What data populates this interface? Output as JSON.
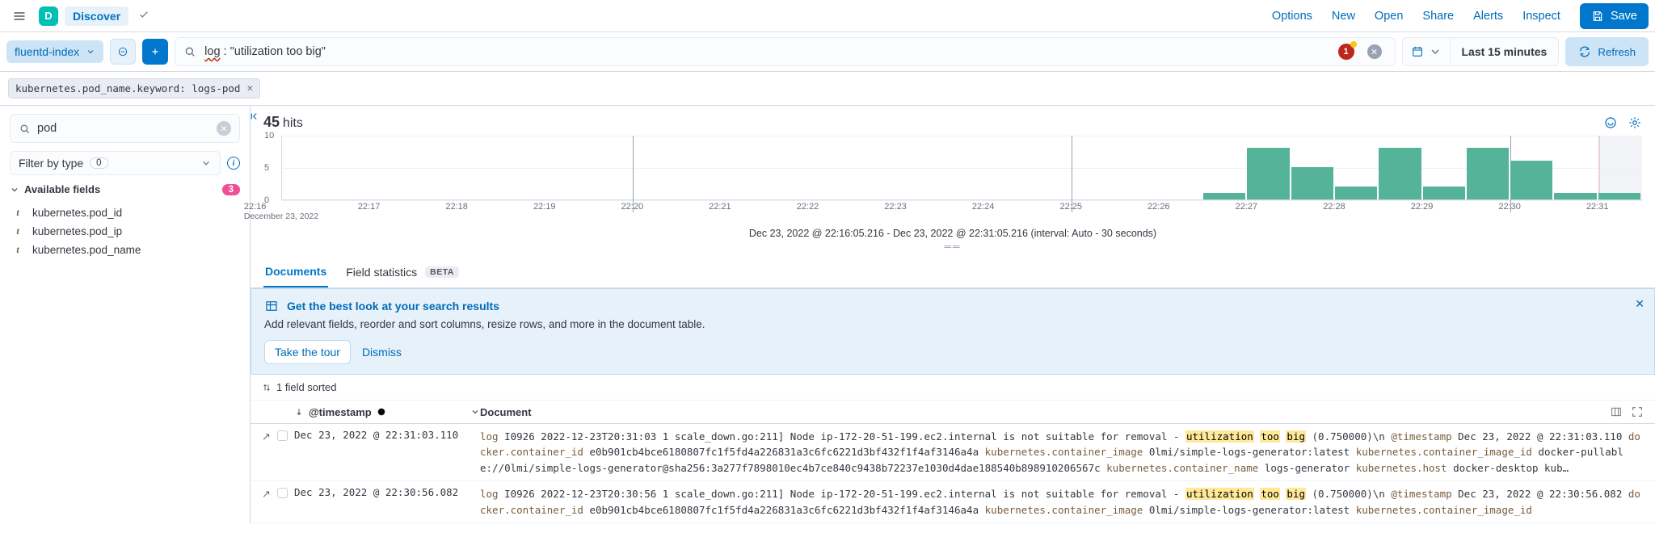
{
  "header": {
    "avatar_letter": "D",
    "app_label": "Discover",
    "links": [
      "Options",
      "New",
      "Open",
      "Share",
      "Alerts",
      "Inspect"
    ],
    "save_label": "Save"
  },
  "query": {
    "index_pattern": "fluentd-index",
    "query_prefix": "log",
    "query_rest": " : \"utilization too big\"",
    "alert_count": "1",
    "date_range": "Last 15 minutes",
    "refresh_label": "Refresh"
  },
  "filters": {
    "chip": "kubernetes.pod_name.keyword: logs-pod"
  },
  "sidebar": {
    "search_value": "pod",
    "filter_by_type_label": "Filter by type",
    "filter_by_type_count": "0",
    "available_label": "Available fields",
    "available_count": "3",
    "fields": [
      {
        "type": "t",
        "name": "kubernetes.pod_id"
      },
      {
        "type": "t",
        "name": "kubernetes.pod_ip"
      },
      {
        "type": "t",
        "name": "kubernetes.pod_name"
      }
    ]
  },
  "hits": {
    "count": "45",
    "word": "hits"
  },
  "chart_data": {
    "type": "bar",
    "y_ticks": [
      0,
      5,
      10
    ],
    "ylim": [
      0,
      10
    ],
    "x_ticks": [
      "22:16",
      "22:17",
      "22:18",
      "22:19",
      "22:20",
      "22:21",
      "22:22",
      "22:23",
      "22:24",
      "22:25",
      "22:26",
      "22:27",
      "22:28",
      "22:29",
      "22:30",
      "22:31"
    ],
    "x_sub_first": "December 23, 2022",
    "vlines_at": [
      "22:20",
      "22:25",
      "22:30"
    ],
    "series": [
      {
        "t": "22:26:30",
        "value": 1
      },
      {
        "t": "22:27:00",
        "value": 8
      },
      {
        "t": "22:27:30",
        "value": 5
      },
      {
        "t": "22:28:00",
        "value": 2
      },
      {
        "t": "22:28:30",
        "value": 8
      },
      {
        "t": "22:29:00",
        "value": 2
      },
      {
        "t": "22:29:30",
        "value": 8
      },
      {
        "t": "22:30:00",
        "value": 6
      },
      {
        "t": "22:30:30",
        "value": 1
      },
      {
        "t": "22:31:00",
        "value": 1
      }
    ],
    "caption": "Dec 23, 2022 @ 22:16:05.216 - Dec 23, 2022 @ 22:31:05.216 (interval: Auto - 30 seconds)"
  },
  "tabs": {
    "documents": "Documents",
    "field_stats": "Field statistics",
    "beta": "BETA"
  },
  "callout": {
    "title": "Get the best look at your search results",
    "body": "Add relevant fields, reorder and sort columns, resize rows, and more in the document table.",
    "tour": "Take the tour",
    "dismiss": "Dismiss"
  },
  "table": {
    "sort_summary": "1 field sorted",
    "col_timestamp": "@timestamp",
    "col_document": "Document",
    "rows": [
      {
        "ts": "Dec 23, 2022 @ 22:31:03.110",
        "log_head": "I0926 2022-12-23T20:31:03 1 scale_down.go:211] Node ip-172-20-51-199.ec2.internal is not suitable for removal - ",
        "hl": [
          "utilization",
          "too",
          "big"
        ],
        "log_tail": " (0.750000)\\n ",
        "ts_field": "Dec 23, 2022 @ 22:31:03.110",
        "cid": "e0b901cb4bce6180807fc1f5fd4a226831a3c6fc6221d3bf432f1f4af3146a4a",
        "cimg": "0lmi/simple-logs-generator:latest",
        "cimg_id": "docker-pullable://0lmi/simple-logs-generator@sha256:3a277f7898010ec4b7ce840c9438b72237e1030d4dae188540b898910206567c",
        "cname": "logs-generator",
        "host": "docker-desktop",
        "trail": "kub…"
      },
      {
        "ts": "Dec 23, 2022 @ 22:30:56.082",
        "log_head": "I0926 2022-12-23T20:30:56 1 scale_down.go:211] Node ip-172-20-51-199.ec2.internal is not suitable for removal - ",
        "hl": [
          "utilization",
          "too",
          "big"
        ],
        "log_tail": " (0.750000)\\n ",
        "ts_field": "Dec 23, 2022 @ 22:30:56.082",
        "cid": "e0b901cb4bce6180807fc1f5fd4a226831a3c6fc6221d3bf432f1f4af3146a4a",
        "cimg": "0lmi/simple-logs-generator:latest",
        "cimg_id2": "kubernetes.container_image_id"
      }
    ]
  }
}
